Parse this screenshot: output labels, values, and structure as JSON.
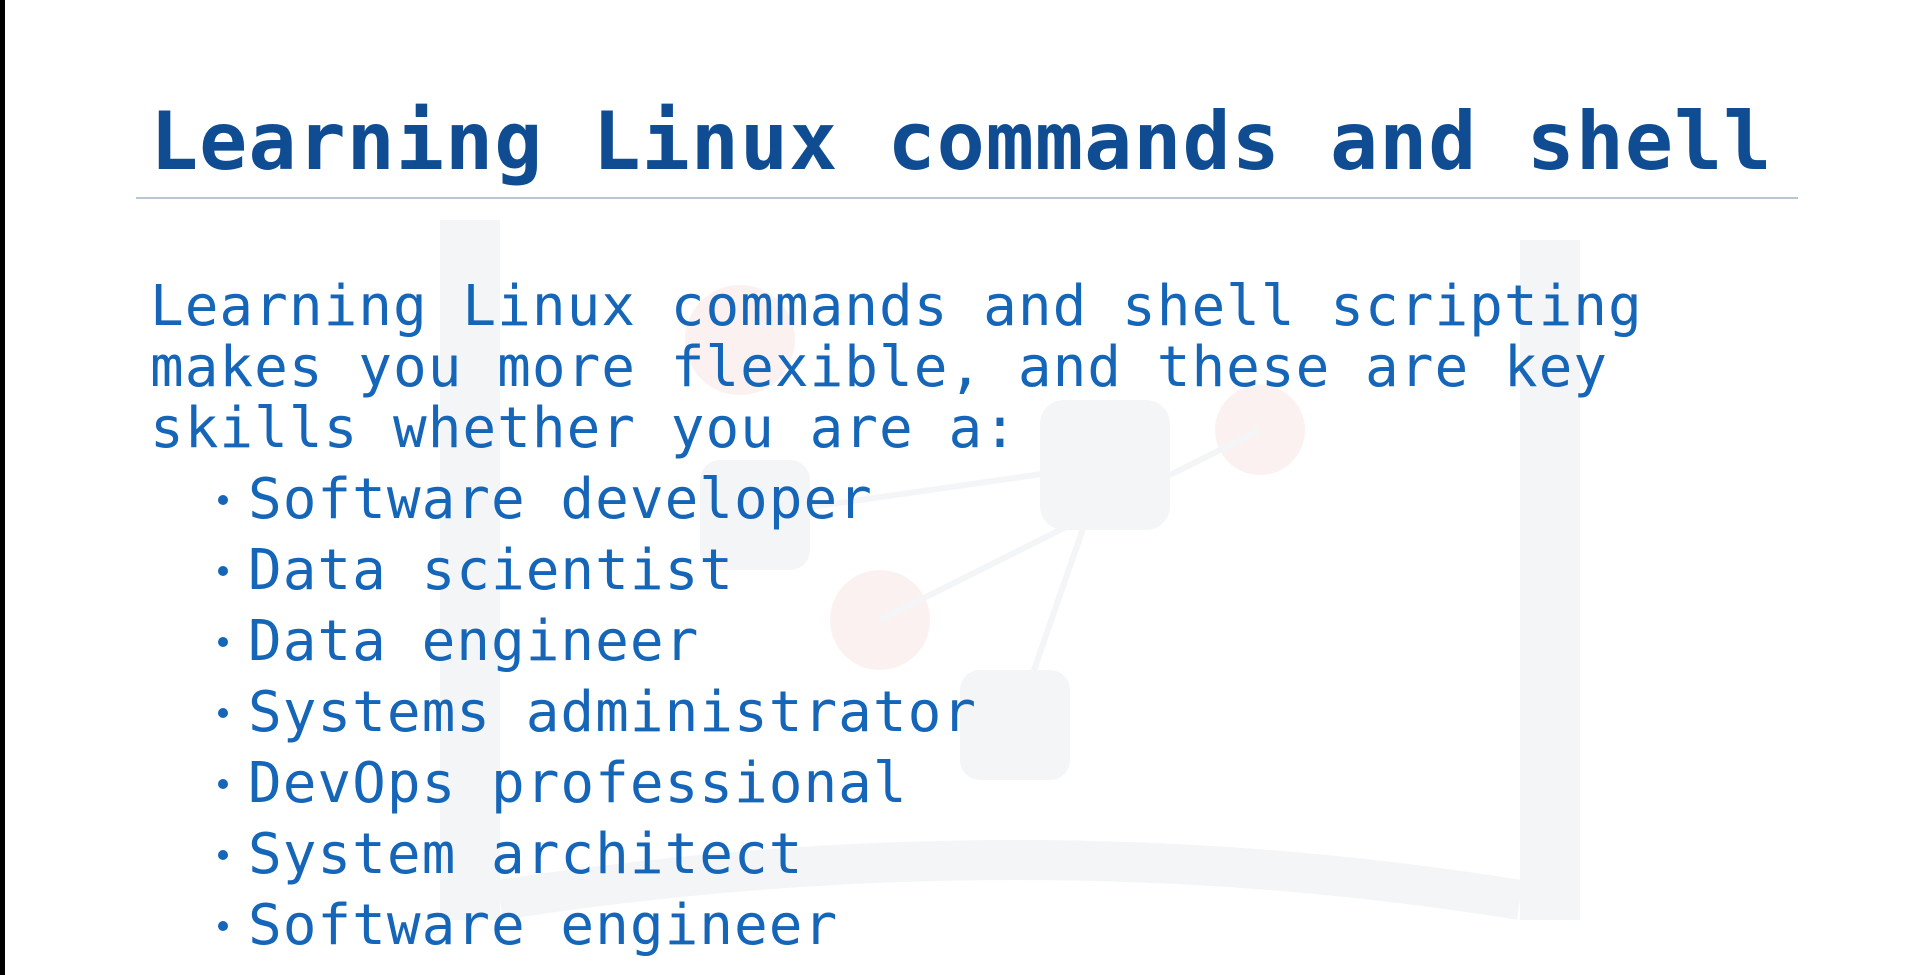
{
  "slide": {
    "title": "Learning Linux commands and shell",
    "intro": "Learning Linux commands and shell scripting makes you more flexible, and these are key skills whether you are a:",
    "bullets": [
      "Software developer",
      "Data scientist",
      "Data engineer",
      "Systems administrator",
      "DevOps professional",
      "System architect",
      "Software engineer"
    ]
  },
  "colors": {
    "title": "#0f4c92",
    "body": "#1565b8",
    "rule": "#b9c6d3"
  }
}
